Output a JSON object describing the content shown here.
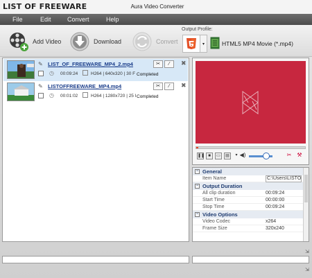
{
  "window": {
    "site_title": "LIST OF FREEWARE",
    "app_title": "Aura Video Converter"
  },
  "menu": {
    "items": [
      "File",
      "Edit",
      "Convert",
      "Help"
    ]
  },
  "toolbar": {
    "add_video": "Add Video",
    "download": "Download",
    "convert": "Convert",
    "output_profile_caption": "Output Profile:",
    "profile_name": "HTML5 MP4 Movie (*.mp4)"
  },
  "files": [
    {
      "name": "LIST_OF_FREEWARE_MP4_2.mp4",
      "duration": "00:09:24",
      "info": "H264 | 640x320 | 30 F",
      "status": "Completed",
      "selected": true
    },
    {
      "name": "LISTOFFREEWARE_MP4.mp4",
      "duration": "00:01:02",
      "info": "H264 | 1280x720 | 25 I",
      "status": "Completed",
      "selected": false
    }
  ],
  "preview": {
    "video_color": "#c7273f",
    "progress": 0.02
  },
  "properties": {
    "sections": [
      {
        "title": "General",
        "rows": [
          {
            "key": "Item Name",
            "value": "C:\\Users\\LISTOFFR..."
          }
        ]
      },
      {
        "title": "Output Duration",
        "rows": [
          {
            "key": "All clip duration",
            "value": "00:09:24"
          },
          {
            "key": "Start Time",
            "value": "00:00:00"
          },
          {
            "key": "Stop Time",
            "value": "00:09:24"
          }
        ]
      },
      {
        "title": "Video Options",
        "rows": [
          {
            "key": "Video Codec",
            "value": "x264"
          },
          {
            "key": "Frame Size",
            "value": "320x240"
          }
        ]
      }
    ]
  },
  "colors": {
    "menubar": "#555555",
    "accent_blue": "#1a3d8a",
    "preview_red": "#c7273f"
  }
}
